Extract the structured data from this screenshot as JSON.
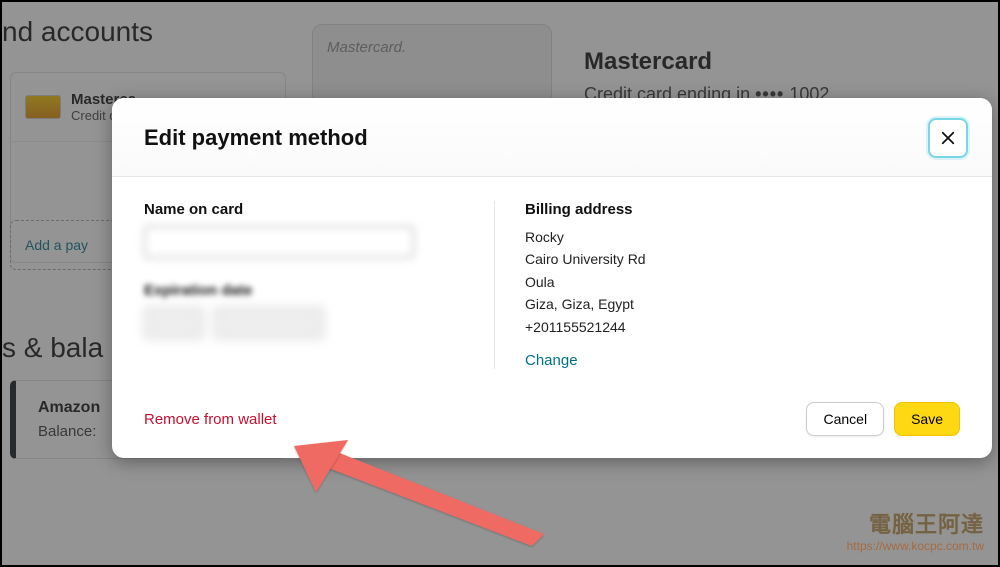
{
  "bg": {
    "accounts_heading_partial": "nd accounts",
    "card_list_item": {
      "network": "Masterca",
      "subtitle": "Credit card"
    },
    "add_payment_partial": "Add a pay",
    "balance_heading_partial": "s & bala",
    "balance_panel": {
      "title": "Amazon",
      "subtitle": "Balance:"
    },
    "card_preview_brand": "Mastercard.",
    "card_network": "Mastercard",
    "card_ending_prefix": "Credit card ending in",
    "card_ending_dots": "••••",
    "card_ending_last4": "1002"
  },
  "modal": {
    "title": "Edit payment method",
    "name_label": "Name on card",
    "name_value": "",
    "expiration_label": "Expiration date",
    "billing_heading": "Billing address",
    "billing_lines": {
      "name": "Rocky",
      "street": "Cairo University Rd",
      "area": "Oula",
      "city_region_country": "Giza, Giza, Egypt",
      "phone": "+201155521244"
    },
    "change_label": "Change",
    "remove_label": "Remove from wallet",
    "cancel_label": "Cancel",
    "save_label": "Save"
  },
  "watermark": {
    "top": "電腦王阿達",
    "bottom": "https://www.kocpc.com.tw"
  }
}
